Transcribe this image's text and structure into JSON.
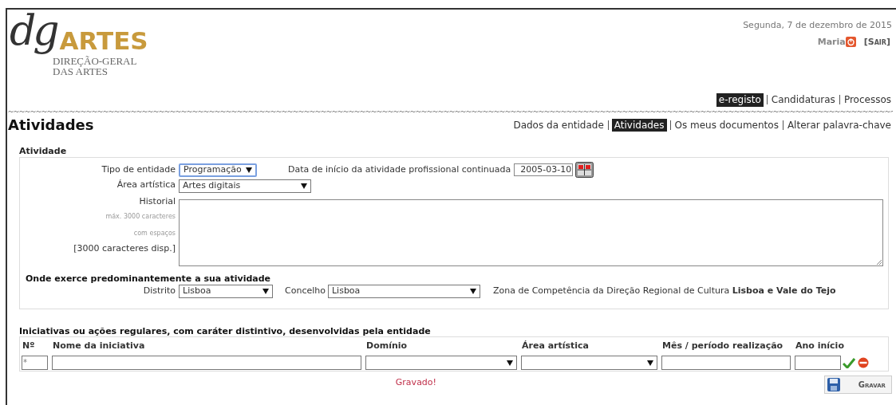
{
  "header": {
    "logo": {
      "mark": "dg",
      "name": "ARTES",
      "line_1": "DIREÇÃO-GERAL",
      "line_2": "DAS ARTES"
    },
    "date": "Segunda, 7 de dezembro de 2015",
    "user": "Maria",
    "logout": "[Sair]"
  },
  "main_nav": [
    {
      "label": "e-registo",
      "selected": true
    },
    {
      "label": "Candidaturas",
      "selected": false
    },
    {
      "label": "Processos",
      "selected": false
    }
  ],
  "page_title": "Atividades",
  "sub_nav": [
    {
      "label": "Dados da entidade",
      "selected": false
    },
    {
      "label": "Atividades",
      "selected": true
    },
    {
      "label": "Os meus documentos",
      "selected": false
    },
    {
      "label": "Alterar palavra-chave",
      "selected": false
    }
  ],
  "activity": {
    "title": "Atividade",
    "entity_type": {
      "label": "Tipo de entidade",
      "value": "Programação",
      "focused": true
    },
    "start_date": {
      "label": "Data de início da atividade profissional continuada",
      "value": "2005-03-10"
    },
    "art_area": {
      "label": "Área artística",
      "value": "Artes digitais"
    },
    "history": {
      "label": "Historial",
      "hint_1": "máx. 3000 caracteres",
      "hint_2": "com espaços",
      "counter": "[3000 caracteres disp.]"
    },
    "location": {
      "title": "Onde exerce predominantemente a sua atividade",
      "district": {
        "label": "Distrito",
        "value": "Lisboa"
      },
      "municipality": {
        "label": "Concelho",
        "value": "Lisboa"
      },
      "zone": "Zona de Competência da Direção Regional de Cultura **Lisboa e Vale do Tejo**"
    }
  },
  "initiatives": {
    "title": "Iniciativas ou ações regulares, com caráter distintivo, desenvolvidas pela entidade",
    "columns": [
      "Nº",
      "Nome da iniciativa",
      "Domínio",
      "Área artística",
      "Mês / período realização",
      "Ano início"
    ],
    "new_row": [
      {
        "kind": "input",
        "placeholder": "*"
      },
      {
        "kind": "input"
      },
      {
        "kind": "select"
      },
      {
        "kind": "select"
      },
      {
        "kind": "input"
      },
      {
        "kind": "input"
      }
    ]
  },
  "status": "Gravado!",
  "save_button": "Gravar"
}
